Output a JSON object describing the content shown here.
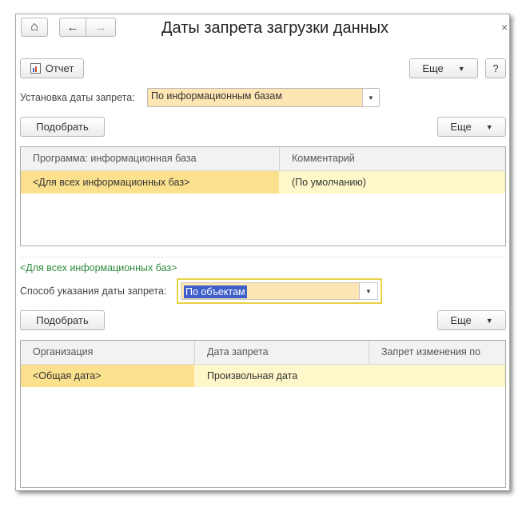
{
  "window": {
    "title": "Даты запрета загрузки данных",
    "close_glyph": "×"
  },
  "nav": {
    "home_icon": "⌂",
    "back_icon": "←",
    "forward_icon": "→"
  },
  "toolbar": {
    "report_label": "Отчет",
    "more_label": "Еще",
    "help_label": "?"
  },
  "setting": {
    "label": "Установка даты запрета:",
    "value": "По информационным базам"
  },
  "top_section": {
    "pick_label": "Подобрать",
    "more_label": "Еще",
    "columns": [
      "Программа: информационная база",
      "Комментарий"
    ],
    "rows": [
      [
        "<Для всех информационных баз>",
        "(По умолчанию)"
      ]
    ]
  },
  "detail": {
    "group_link": "<Для всех информационных баз>",
    "method_label": "Способ указания даты запрета:",
    "method_value": "По объектам",
    "pick_label": "Подобрать",
    "more_label": "Еще",
    "columns": [
      "Организация",
      "Дата запрета",
      "Запрет изменения по"
    ],
    "rows": [
      [
        "<Общая дата>",
        "Произвольная дата",
        ""
      ]
    ]
  },
  "icons": {
    "dropdown": "▼",
    "report": "report-icon"
  }
}
